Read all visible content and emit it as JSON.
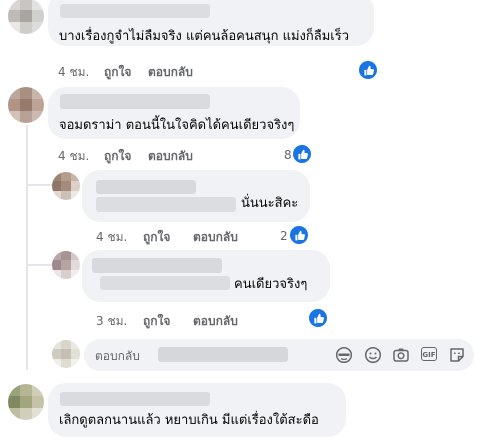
{
  "comments": [
    {
      "text": "บางเรื่องกูจำไม่ลืมจริง แต่คนล้อคนสนุก แม่งก็ลืมเร็ว",
      "time": "4 ชม.",
      "like_label": "ถูกใจ",
      "reply_label": "ตอบกลับ",
      "reaction_count": ""
    },
    {
      "text": "จอมดราม่า ตอนนี้ในใจคิดได้คนเดียวจริงๆ",
      "time": "4 ชม.",
      "like_label": "ถูกใจ",
      "reply_label": "ตอบกลับ",
      "reaction_count": "8"
    },
    {
      "text": "นั่นนะสิคะ",
      "time": "4 ชม.",
      "like_label": "ถูกใจ",
      "reply_label": "ตอบกลับ",
      "reaction_count": "2"
    },
    {
      "text": "คนเดียวจริงๆ",
      "time": "3 ชม.",
      "like_label": "ถูกใจ",
      "reply_label": "ตอบกลับ",
      "reaction_count": ""
    },
    {
      "text": "เลิกดูตลกนานแล้ว หยาบเกิน มีแต่เรื่องใต้สะดือ",
      "time": "",
      "like_label": "",
      "reply_label": "",
      "reaction_count": ""
    }
  ],
  "reply_box": {
    "placeholder": "ตอบกลับ"
  },
  "icons": [
    "like-reaction-icon",
    "emoji-mask-icon",
    "smiley-icon",
    "camera-icon",
    "gif-icon",
    "sticker-icon"
  ],
  "colors": {
    "like_blue": "#1b74e4",
    "bubble_bg": "#f0f2f5",
    "meta_text": "#65676b"
  }
}
